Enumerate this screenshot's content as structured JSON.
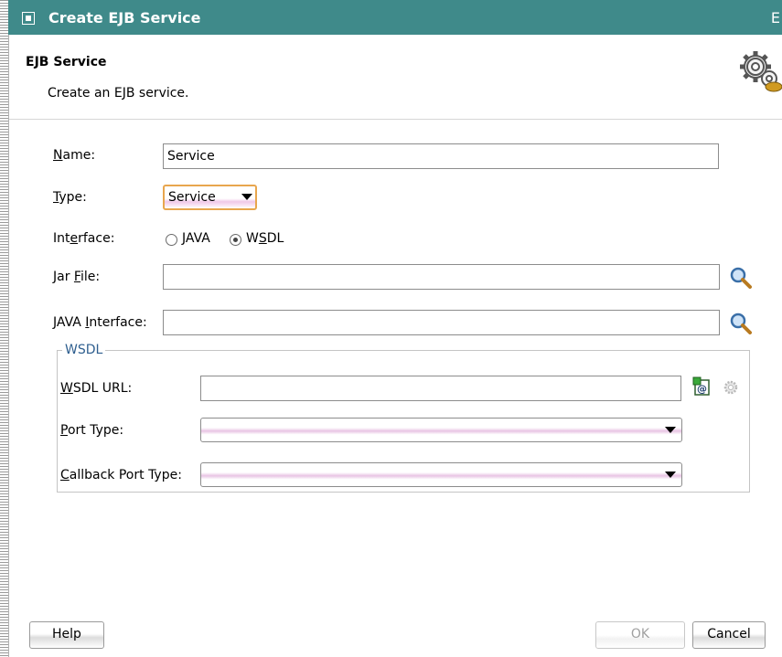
{
  "window": {
    "title": "Create EJB Service",
    "edge_glyph": "E"
  },
  "header": {
    "title": "EJB Service",
    "description": "Create an EJB service.",
    "icon": "gears-icon"
  },
  "form": {
    "name": {
      "label_prefix": "",
      "label_mnemonic": "N",
      "label_rest": "ame:",
      "value": "Service"
    },
    "type": {
      "label_mnemonic": "T",
      "label_rest": "ype:",
      "selected": "Service"
    },
    "interface": {
      "label_prefix": "Int",
      "label_mnemonic": "e",
      "label_rest": "rface:",
      "options": [
        {
          "mnemonic": "J",
          "rest": "AVA",
          "checked": false
        },
        {
          "prefix": "W",
          "mnemonic": "S",
          "rest": "DL",
          "checked": true
        }
      ]
    },
    "jar_file": {
      "label_prefix": "Jar ",
      "label_mnemonic": "F",
      "label_rest": "ile:",
      "value": ""
    },
    "java_interface": {
      "label_prefix": "JAVA ",
      "label_mnemonic": "I",
      "label_rest": "nterface:",
      "value": ""
    }
  },
  "wsdl_group": {
    "legend": "WSDL",
    "wsdl_url": {
      "label_mnemonic": "W",
      "label_rest": "SDL URL:",
      "value": ""
    },
    "port_type": {
      "label_mnemonic": "P",
      "label_rest": "ort Type:",
      "selected": ""
    },
    "callback_port_type": {
      "label_mnemonic": "C",
      "label_rest": "allback Port Type:",
      "selected": ""
    }
  },
  "buttons": {
    "help": "Help",
    "ok": "OK",
    "cancel": "Cancel"
  },
  "colors": {
    "titlebar": "#3f8a8a",
    "group_legend": "#2f5f8f",
    "focus_border": "#e8a64e"
  }
}
